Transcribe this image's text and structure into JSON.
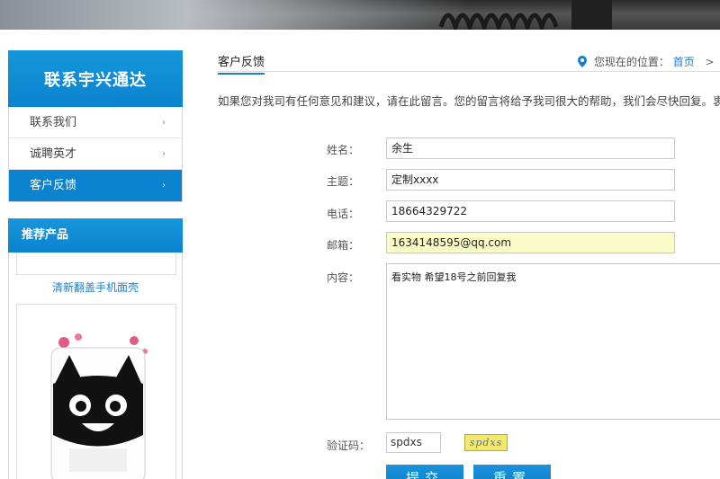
{
  "sidebar": {
    "title": "联系宇兴通达",
    "items": [
      {
        "label": "联系我们",
        "arrow": "›"
      },
      {
        "label": "诚聘英才",
        "arrow": "›"
      },
      {
        "label": "客户反馈",
        "arrow": "›"
      }
    ],
    "active_index": 2
  },
  "products": {
    "title": "推荐产品",
    "items": [
      {
        "caption": "清新翻盖手机面壳"
      }
    ]
  },
  "header": {
    "section_title": "客户反馈",
    "location_label": "您现在的位置：",
    "home_link": "首页",
    "separator": ">"
  },
  "intro": "如果您对我司有任何意见和建议，请在此留言。您的留言将给予我司很大的帮助，我们会尽快回复。衷",
  "form": {
    "name_label": "姓名：",
    "name_value": "余生",
    "subject_label": "主题：",
    "subject_value": "定制xxxx",
    "phone_label": "电话：",
    "phone_value": "18664329722",
    "email_label": "邮箱：",
    "email_value": "1634148595@qq.com",
    "content_label": "内容：",
    "content_value": "看实物  希望18号之前回复我",
    "captcha_label": "验证码：",
    "captcha_value": "spdxs",
    "captcha_image_text": "spdxs",
    "submit_label": "提交",
    "reset_label": "重置"
  },
  "colors": {
    "accent": "#0b83cf",
    "autofill": "#fafcc8",
    "captcha_bg": "#f2e86a"
  }
}
